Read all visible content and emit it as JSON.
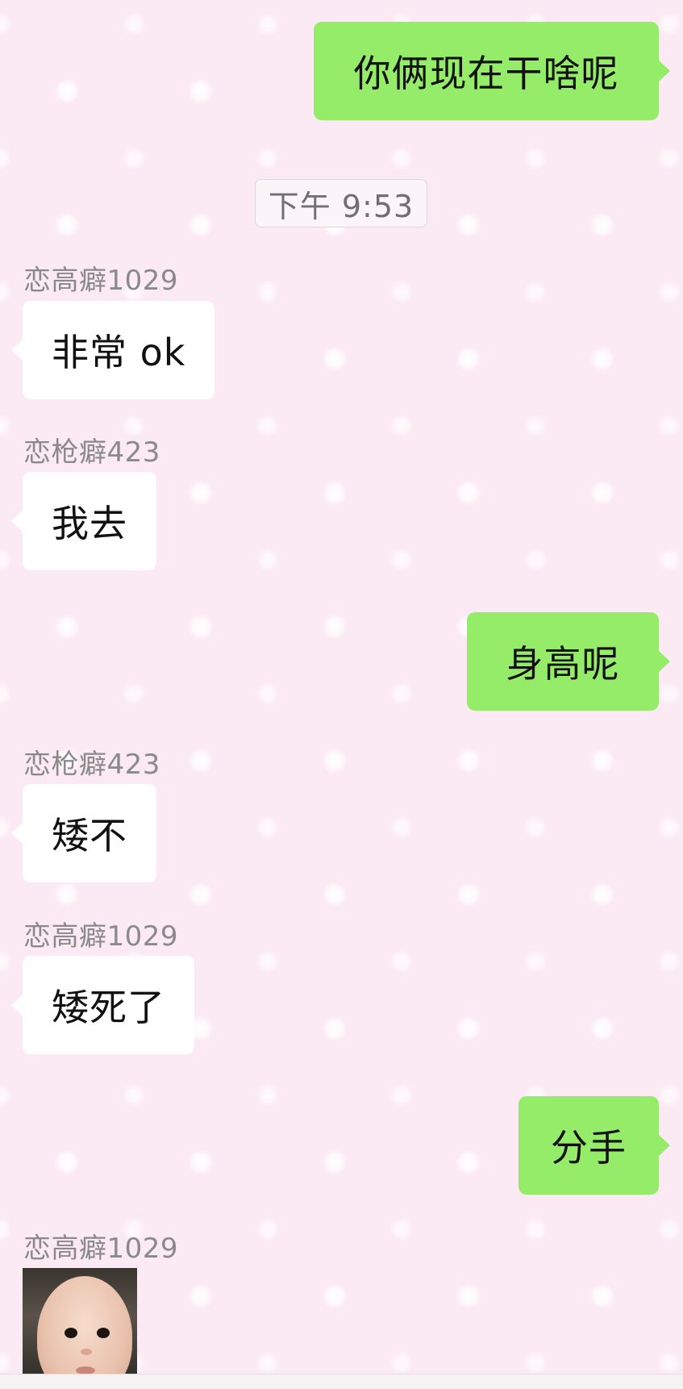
{
  "chat": {
    "messages": [
      {
        "direction": "out",
        "text": "你俩现在干啥呢"
      },
      {
        "type": "timestamp",
        "text": "下午 9:53"
      },
      {
        "direction": "in",
        "sender": "恋高癖1029",
        "text": "非常 ok"
      },
      {
        "direction": "in",
        "sender": "恋枪癖423",
        "text": "我去"
      },
      {
        "direction": "out",
        "text": "身高呢"
      },
      {
        "direction": "in",
        "sender": "恋枪癖423",
        "text": "矮不"
      },
      {
        "direction": "in",
        "sender": "恋高癖1029",
        "text": "矮死了"
      },
      {
        "direction": "out",
        "text": "分手"
      },
      {
        "direction": "in",
        "sender": "恋高癖1029",
        "type": "image",
        "image_content": "baby-face-photo"
      }
    ]
  },
  "colors": {
    "outgoing_bubble": "#95ec69",
    "incoming_bubble": "#ffffff",
    "background": "#fbeaf3",
    "sender_name": "#8a8a8a"
  }
}
